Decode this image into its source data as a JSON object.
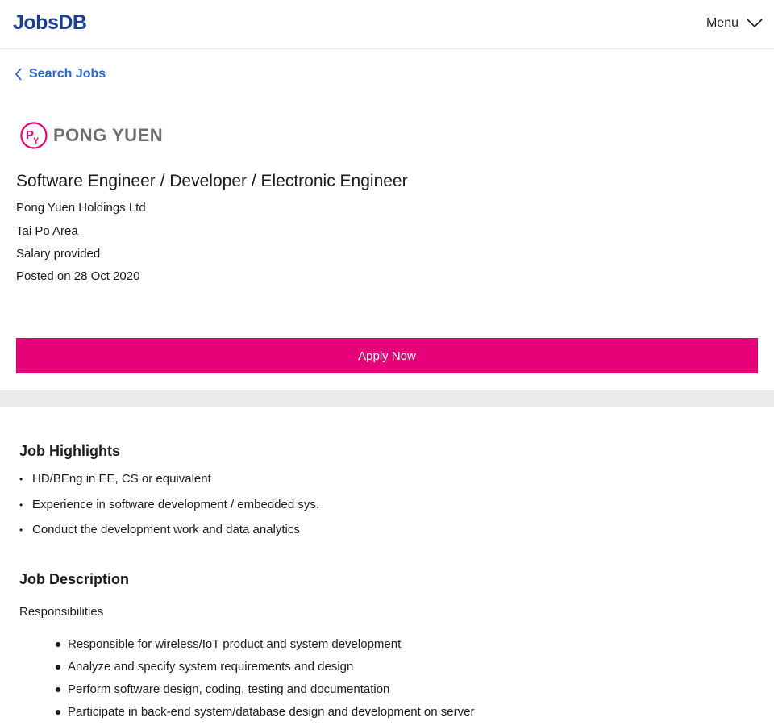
{
  "header": {
    "logo_text": "JobsDB",
    "menu_label": "Menu",
    "menu_icon": "chevron-down-icon"
  },
  "nav": {
    "back_label": "Search Jobs",
    "back_icon": "chevron-left-icon"
  },
  "company_logo": {
    "text": "PONG YUEN",
    "monogram": "PY",
    "brand_color": "#e60278",
    "text_color": "#6d6e70"
  },
  "job": {
    "title": "Software Engineer / Developer / Electronic Engineer",
    "company": "Pong Yuen Holdings Ltd",
    "location": "Tai Po Area",
    "salary": "Salary provided",
    "posted_prefix": "Posted on",
    "posted_date": "28 Oct 2020"
  },
  "apply_button": {
    "label": "Apply Now",
    "color": "#e60278"
  },
  "highlights": {
    "title": "Job Highlights",
    "items": [
      "HD/BEng in EE, CS or equivalent",
      "Experience in software development / embedded sys.",
      "Conduct the development work and data analytics"
    ]
  },
  "description": {
    "title": "Job Description",
    "responsibilities_label": "Responsibilities",
    "responsibilities": [
      "Responsible for wireless/IoT product and system development",
      "Analyze and specify system requirements and design",
      "Perform software design, coding, testing and documentation",
      "Participate in back-end system/database design and development on server"
    ]
  },
  "colors": {
    "brand_blue": "#1c3f94",
    "link_blue": "#2e66d3",
    "accent_pink": "#e60278"
  }
}
